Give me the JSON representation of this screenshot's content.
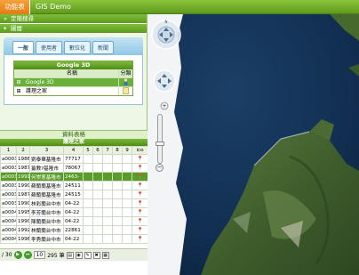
{
  "header": {
    "tab": "功能表",
    "title": "GIS Demo"
  },
  "accordion": [
    {
      "arrow": "»",
      "label": "定階搜尋"
    },
    {
      "arrow": "▾",
      "label": "圖層"
    }
  ],
  "tabs": [
    "一般",
    "使用者",
    "數位化",
    "新聞"
  ],
  "layers": {
    "title": "Google 3D",
    "col_name": "名稱",
    "col_cat": "分類",
    "rows": [
      {
        "exp": "⊞",
        "name": "Google 3D",
        "cat": "",
        "selected": true
      },
      {
        "exp": "⊞",
        "name": "護理之家",
        "cat": "",
        "selected": false
      }
    ]
  },
  "table": {
    "title": "資料表格",
    "subtitle": "護理之家",
    "columns": [
      "1",
      "2",
      "3",
      "4",
      "5",
      "6",
      "7",
      "8",
      "9",
      "ico"
    ],
    "rows": [
      [
        "a0003",
        "1986",
        "劉泰華基隆市",
        "77717",
        "",
        "",
        "",
        "",
        "",
        "📍"
      ],
      [
        "a0003",
        "1987",
        "薑教?基隆市",
        "78067",
        "",
        "",
        "",
        "",
        "",
        "📍"
      ],
      [
        "a0003",
        "1991",
        "何崇蔥基隆市",
        "2463-",
        "",
        "",
        "",
        "",
        "",
        "📍"
      ],
      [
        "a0003",
        "1990",
        "蘇蘭蘭基隆市",
        "24511",
        "",
        "",
        "",
        "",
        "",
        "📍"
      ],
      [
        "a0003",
        "1987",
        "蘇蘭蘭基隆市",
        "24515",
        "",
        "",
        "",
        "",
        "",
        "📍"
      ],
      [
        "a0003",
        "1990",
        "林彩蘭台中市",
        "04-22",
        "",
        "",
        "",
        "",
        "",
        "📍"
      ],
      [
        "a0004",
        "1995",
        "李芳蘭台中市",
        "04-22",
        "",
        "",
        "",
        "",
        "",
        "📍"
      ],
      [
        "a0004",
        "1990",
        "陳蘭蘭台中市",
        "04-22",
        "",
        "",
        "",
        "",
        "",
        "📍"
      ],
      [
        "a0004",
        "1992",
        "林蘭蘭台中市",
        "22861",
        "",
        "",
        "",
        "",
        "",
        "📍"
      ],
      [
        "a0004",
        "1996",
        "李秀蘭台中市",
        "04-22",
        "",
        "",
        "",
        "",
        "",
        "📍"
      ]
    ],
    "selected_row": 2
  },
  "pager": {
    "total": "/ 30",
    "page_size": "10",
    "count": "295 筆"
  }
}
